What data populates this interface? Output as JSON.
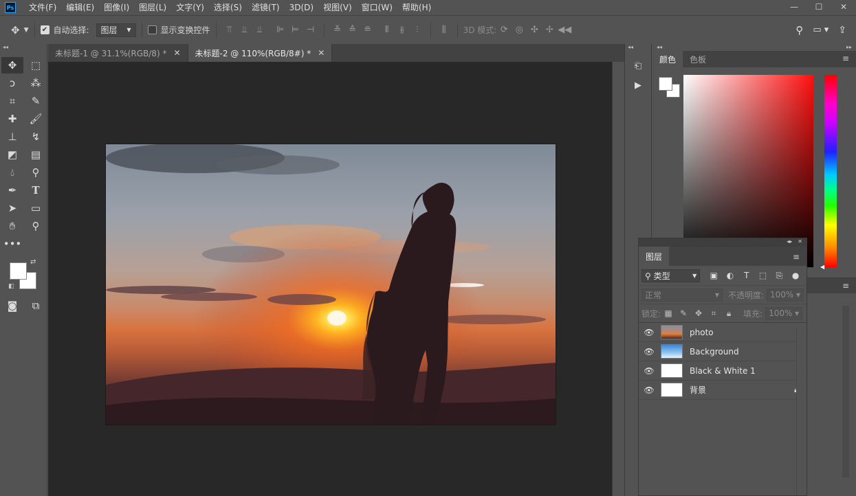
{
  "app": {
    "logo_text": "Ps"
  },
  "menu": [
    "文件(F)",
    "编辑(E)",
    "图像(I)",
    "图层(L)",
    "文字(Y)",
    "选择(S)",
    "滤镜(T)",
    "3D(D)",
    "视图(V)",
    "窗口(W)",
    "帮助(H)"
  ],
  "window_controls": {
    "minimize": "—",
    "maximize": "☐",
    "close": "✕"
  },
  "options": {
    "auto_select_label": "自动选择:",
    "auto_select_checked": true,
    "auto_select_target": "图层",
    "show_transform_label": "显示变换控件",
    "show_transform_checked": false,
    "mode_3d_label": "3D 模式:"
  },
  "tabs": [
    {
      "label": "未标题-1 @ 31.1%(RGB/8) *",
      "close": "✕",
      "active": false
    },
    {
      "label": "未标题-2 @ 110%(RGB/8#) *",
      "close": "✕",
      "active": true
    }
  ],
  "color_panel": {
    "tabs": [
      "颜色",
      "色板"
    ],
    "active_tab": "颜色",
    "foreground": "#ffffff",
    "background": "#ffffff",
    "hue": "#ff0000"
  },
  "layers_panel": {
    "tab": "图层",
    "filter_label": "类型",
    "blend_mode": "正常",
    "opacity_label": "不透明度:",
    "opacity_value": "100%",
    "lock_label": "锁定:",
    "fill_label": "填充:",
    "fill_value": "100%",
    "layers": [
      {
        "name": "photo",
        "thumb": "sunset",
        "locked": false,
        "visible": true
      },
      {
        "name": "Background",
        "thumb": "sky",
        "locked": false,
        "visible": true
      },
      {
        "name": "Black & White 1",
        "thumb": "white",
        "locked": false,
        "visible": true
      },
      {
        "name": "背景",
        "thumb": "white",
        "locked": true,
        "visible": true
      }
    ]
  }
}
